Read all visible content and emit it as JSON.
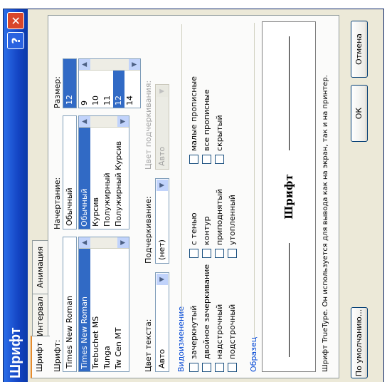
{
  "window": {
    "title": "Шрифт",
    "help_glyph": "?",
    "close_glyph": "✕"
  },
  "tabs": [
    {
      "label": "Шрифт",
      "active": true
    },
    {
      "label": "Интервал",
      "active": false
    },
    {
      "label": "Анимация",
      "active": false
    }
  ],
  "font": {
    "label": "Шрифт:",
    "value": "Times New Roman",
    "items": [
      "Times New Roman",
      "Trebuchet MS",
      "Tunga",
      "Tw Cen MT"
    ],
    "selected_index": 0
  },
  "style": {
    "label": "Начертание:",
    "value": "Обычный",
    "items": [
      "Обычный",
      "Курсив",
      "Полужирный",
      "Полужирный Курсив"
    ],
    "selected_index": 0
  },
  "size": {
    "label": "Размер:",
    "value": "12",
    "items": [
      "9",
      "10",
      "11",
      "12",
      "14"
    ],
    "selected_index": 3
  },
  "font_color": {
    "label": "Цвет текста:",
    "value": "Авто"
  },
  "underline": {
    "label": "Подчеркивание:",
    "value": "(нет)"
  },
  "underline_color": {
    "label": "Цвет подчеркивания:",
    "value": "Авто"
  },
  "effects": {
    "title": "Видоизменение",
    "col1": [
      "зачеркнутый",
      "двойное зачеркивание",
      "надстрочный",
      "подстрочный"
    ],
    "col2": [
      "с тенью",
      "контур",
      "приподнятый",
      "утопленный"
    ],
    "col3": [
      "малые прописные",
      "все прописные",
      "скрытый"
    ]
  },
  "preview": {
    "title": "Образец",
    "sample": "Шрифт",
    "note": "Шрифт TrueType. Он используется для вывода как на экран, так и на принтер."
  },
  "buttons": {
    "default": "По умолчанию...",
    "ok": "ОК",
    "cancel": "Отмена"
  },
  "scroll_glyphs": {
    "up": "▲",
    "down": "▼"
  }
}
